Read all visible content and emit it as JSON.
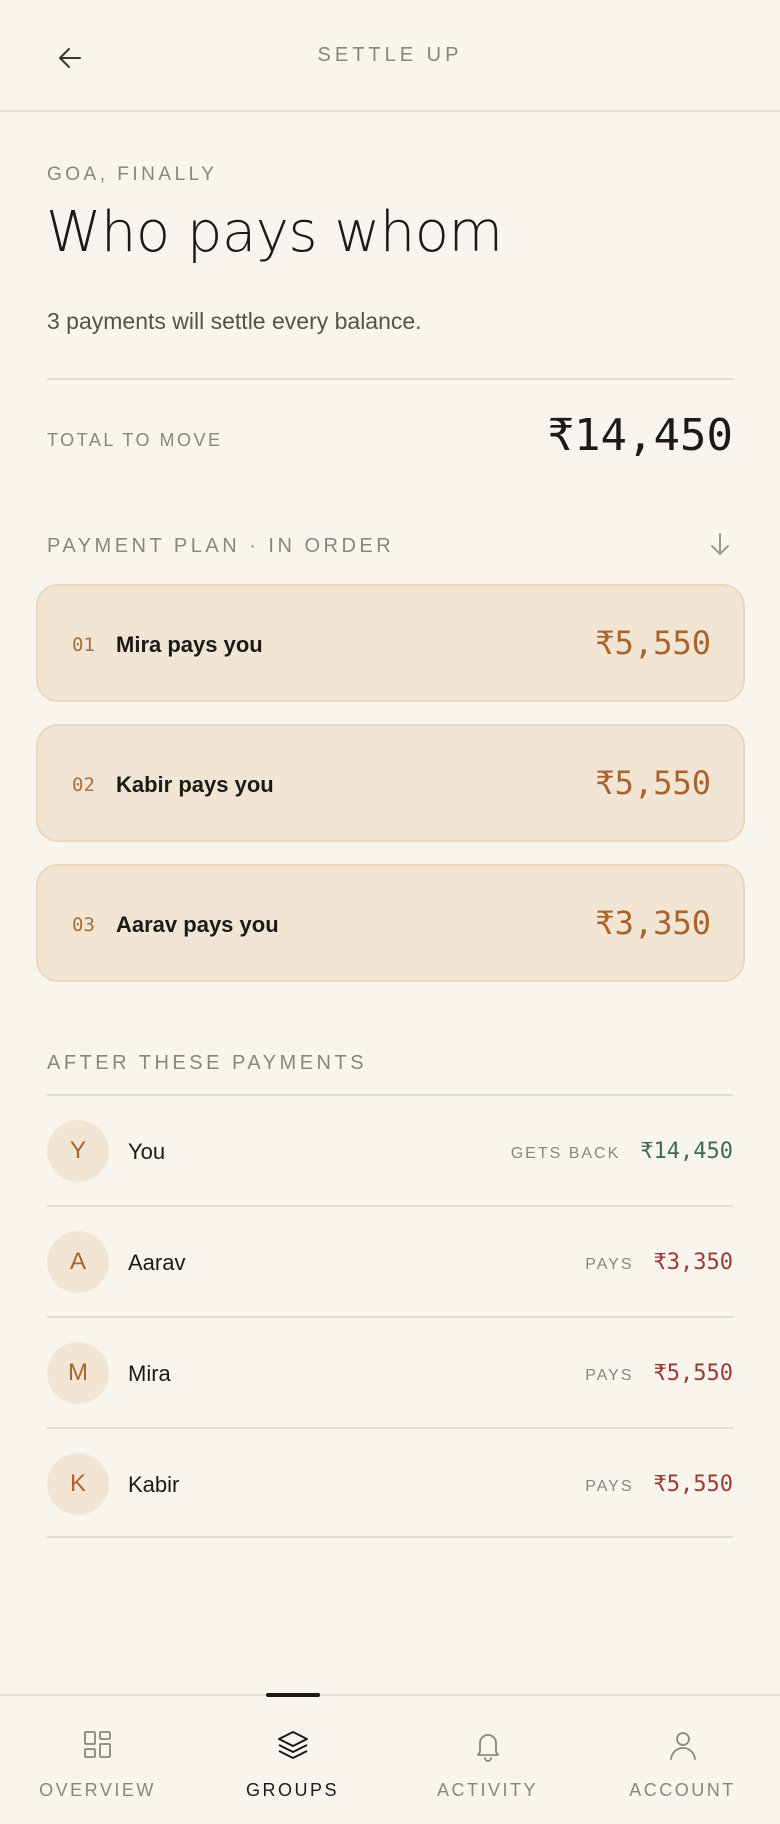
{
  "header": {
    "title": "SETTLE UP"
  },
  "group": {
    "name": "GOA, FINALLY"
  },
  "heading": "Who pays whom",
  "subtitle": "3 payments will settle every balance.",
  "total": {
    "label": "TOTAL TO MOVE",
    "value": "₹14,450"
  },
  "plan": {
    "label": "PAYMENT PLAN · IN ORDER",
    "items": [
      {
        "num": "01",
        "text": "Mira pays you",
        "amount": "₹5,550"
      },
      {
        "num": "02",
        "text": "Kabir pays you",
        "amount": "₹5,550"
      },
      {
        "num": "03",
        "text": "Aarav pays you",
        "amount": "₹3,350"
      }
    ]
  },
  "after": {
    "label": "AFTER THESE PAYMENTS",
    "rows": [
      {
        "initial": "Y",
        "name": "You",
        "tag": "GETS BACK",
        "amount": "₹14,450",
        "color": "#3f6b52"
      },
      {
        "initial": "A",
        "name": "Aarav",
        "tag": "PAYS",
        "amount": "₹3,350",
        "color": "#9a3a32"
      },
      {
        "initial": "M",
        "name": "Mira",
        "tag": "PAYS",
        "amount": "₹5,550",
        "color": "#9a3a32"
      },
      {
        "initial": "K",
        "name": "Kabir",
        "tag": "PAYS",
        "amount": "₹5,550",
        "color": "#9a3a32"
      }
    ]
  },
  "nav": {
    "items": [
      {
        "label": "OVERVIEW",
        "icon": "grid-icon"
      },
      {
        "label": "GROUPS",
        "icon": "layers-icon",
        "active": true
      },
      {
        "label": "ACTIVITY",
        "icon": "bell-icon"
      },
      {
        "label": "ACCOUNT",
        "icon": "user-icon"
      }
    ]
  },
  "colors": {
    "background": "#f8f5ef",
    "accent": "#a8642e",
    "card": "#f3e5d3",
    "positive": "#3f6b52",
    "negative": "#9a3a32"
  }
}
